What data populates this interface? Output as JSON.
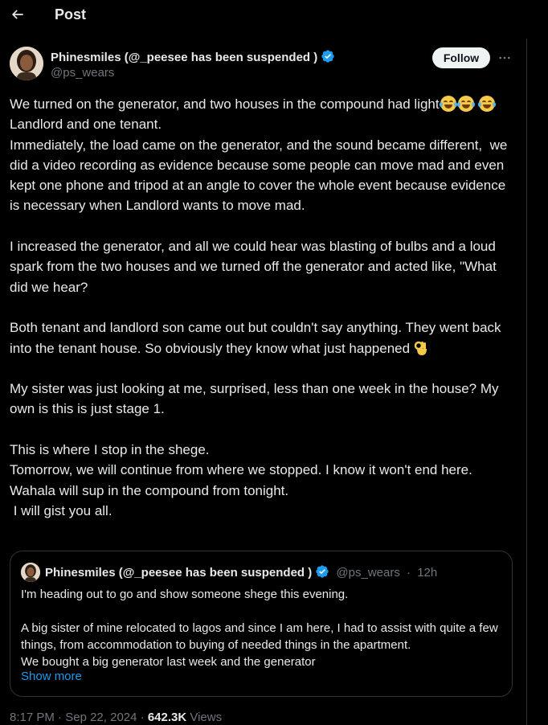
{
  "header": {
    "title": "Post",
    "back_icon": "arrow-left-icon"
  },
  "author": {
    "display_name": "Phinesmiles (@_peesee has been suspended )",
    "handle": "@ps_wears",
    "follow_label": "Follow",
    "verified_icon": "verified-badge-icon",
    "more_icon": "more-horizontal-icon"
  },
  "post": {
    "line1": "We turned on the generator, and two houses in the compound had light",
    "line2": "Landlord and one tenant.",
    "line3": "Immediately, the load came on the generator, and the sound became different,  we did a video recording as evidence because some people can move mad and even kept one phone and tripod at an angle to cover the whole event because evidence is necessary when Landlord wants to move mad.",
    "line4": "I increased the generator, and all we could hear was blasting of bulbs and a loud spark from the two houses and we turned off the generator and acted like, \"What did we hear?",
    "line5": "Both tenant and landlord son came out but couldn't say anything. They went back into the tenant house. So obviously they know what just happened",
    "line6": "My sister was just looking at me, surprised, less than one week in the house? My own is this is just stage 1.",
    "line7": "This is where I stop in the shege.",
    "line8": "Tomorrow, we will continue from where we stopped. I know it won't end here.",
    "line9": "Wahala will sup in the compound from tonight.",
    "line10": " I will gist you all."
  },
  "quote": {
    "display_name": "Phinesmiles (@_peesee has been suspended )",
    "handle": "@ps_wears",
    "separator": "·",
    "age": "12h",
    "line1": "I'm heading out to go and show someone shege this evening.",
    "line2": "A big sister of mine relocated to lagos and since I am here, I had to assist with quite a few things, from accommodation to buying of needed things in the apartment.",
    "line3": "We bought a big generator last week and the generator",
    "show_more": "Show more"
  },
  "meta": {
    "time": "8:17 PM",
    "date": "Sep 22, 2024",
    "separator": "·",
    "views_count": "642.3K",
    "views_label": "Views"
  },
  "colors": {
    "background": "#000000",
    "text": "#e7e9ea",
    "secondary": "#71767b",
    "accent": "#1d9bf0",
    "border": "#2f3336"
  }
}
